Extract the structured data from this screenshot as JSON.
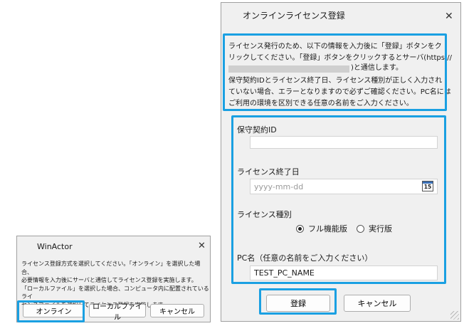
{
  "small_dialog": {
    "title": "WinActor",
    "message": "ライセンス登録方式を選択してください。「オンライン」を選択した場合、\n必要情報を入力後にサーバと通信してライセンス登録を実施します。\n「ローカルファイル」を選択した場合、コンピュータ内に配置されているライ\nセンスファイルを選択してライセンス登録を実施します。",
    "buttons": {
      "online": "オンライン",
      "local_file": "ローカルファイル",
      "cancel": "キャンセル"
    }
  },
  "large_dialog": {
    "title": "オンラインライセンス登録",
    "message_1": "ライセンス発行のため、以下の情報を入力後に「登録」ボタンをク\nリックしてください。「登録」ボタンをクリックするとサーバ(https://",
    "message_url_suffix": ")と通信します。",
    "message_2": "保守契約IDとライセンス終了日、ライセンス種別が正しく入力され\nていない場合、エラーとなりますので必ずご確認ください。PC名には\nご利用の環境を区別できる任意の名前をご入力ください。",
    "fields": {
      "contract_id": {
        "label": "保守契約ID",
        "value": ""
      },
      "end_date": {
        "label": "ライセンス終了日",
        "placeholder": "yyyy-mm-dd",
        "calendar_day": "15"
      },
      "license_type": {
        "label": "ライセンス種別",
        "options": [
          "フル機能版",
          "実行版"
        ],
        "selected": "フル機能版"
      },
      "pc_name": {
        "label": "PC名（任意の名前をご入力ください）",
        "value": "TEST_PC_NAME"
      }
    },
    "buttons": {
      "register": "登録",
      "cancel": "キャンセル"
    }
  },
  "colors": {
    "highlight": "#1aa0e2",
    "dialog_bg": "#f0f0f0"
  }
}
